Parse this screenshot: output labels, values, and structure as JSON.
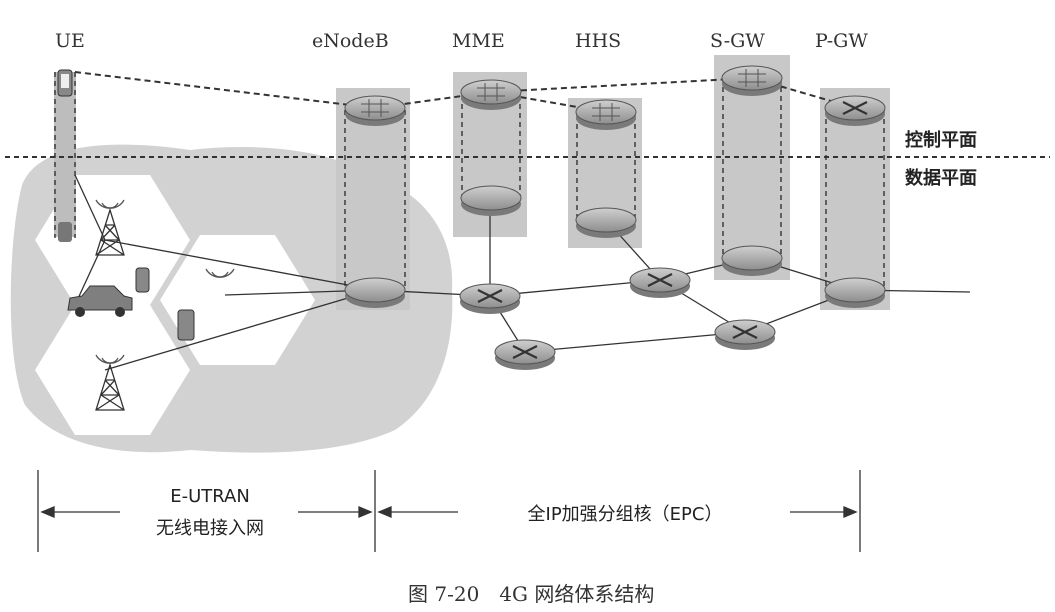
{
  "nodes": {
    "ue": "UE",
    "enodeb": "eNodeB",
    "mme": "MME",
    "hhs": "HHS",
    "sgw": "S-GW",
    "pgw": "P-GW"
  },
  "planes": {
    "control": "控制平面",
    "data": "数据平面"
  },
  "spans": {
    "eutran_line1": "E-UTRAN",
    "eutran_line2": "无线电接入网",
    "epc": "全IP加强分组核（EPC）"
  },
  "caption": "图 7-20　4G 网络体系结构",
  "colors": {
    "coverage_area": "#d2d2d2",
    "node_column": "#c8c8c8",
    "router": "#9a9a9a",
    "line": "#333333"
  },
  "icons": [
    "router-icon",
    "switch-icon",
    "cell-tower-icon",
    "phone-icon",
    "car-icon"
  ]
}
